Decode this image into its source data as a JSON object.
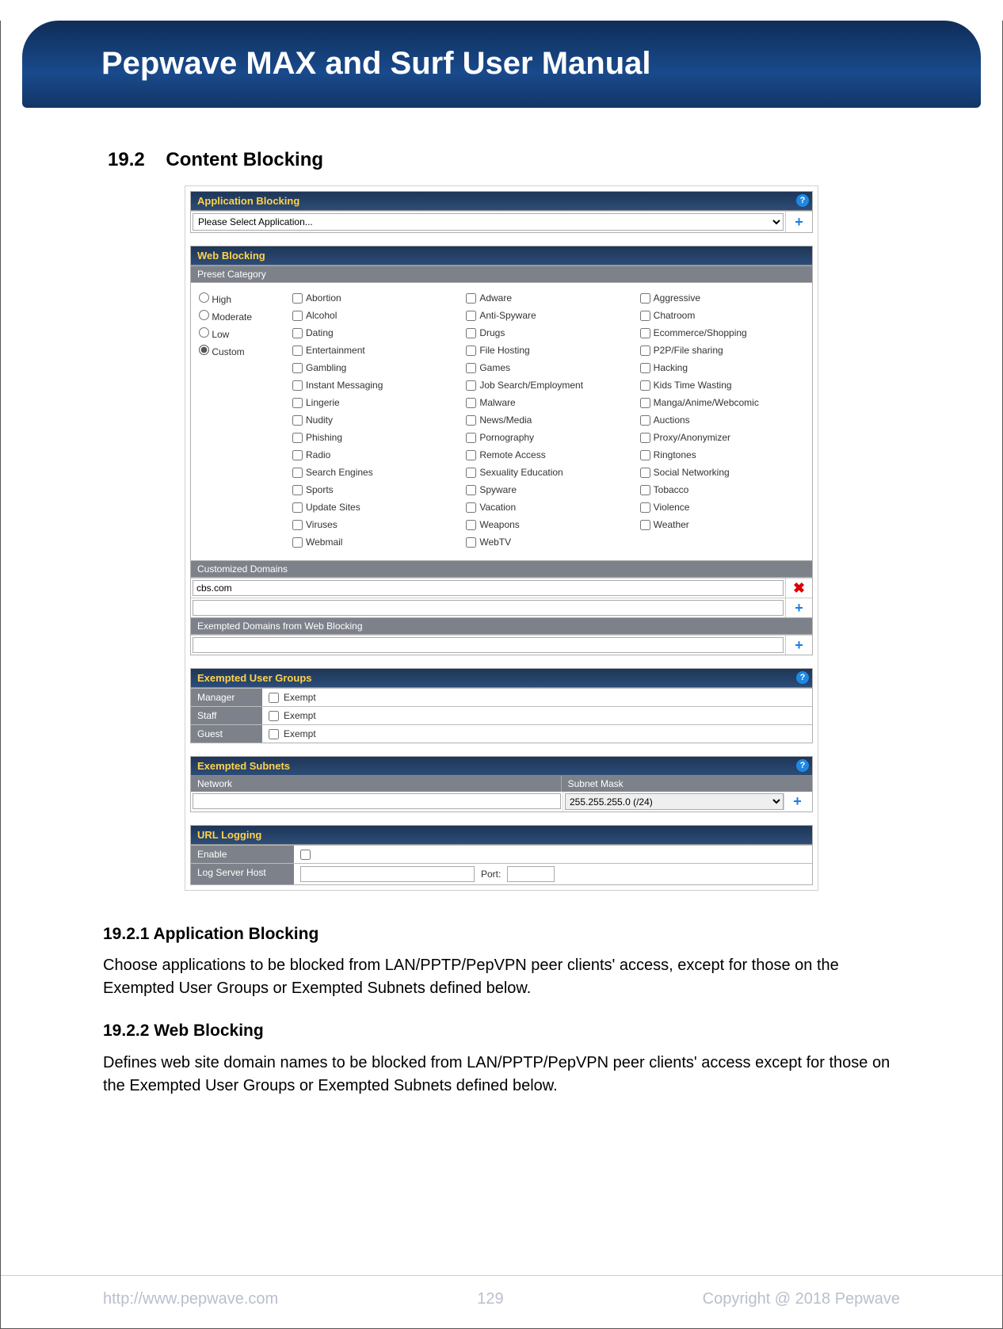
{
  "header": {
    "title": "Pepwave MAX and Surf User Manual"
  },
  "section": {
    "num": "19.2",
    "title": "Content Blocking"
  },
  "app_block": {
    "title": "Application Blocking",
    "select_placeholder": "Please Select Application..."
  },
  "web_block": {
    "title": "Web Blocking",
    "preset_label": "Preset Category",
    "presets": [
      "High",
      "Moderate",
      "Low",
      "Custom"
    ],
    "selected_preset": "Custom",
    "categories_col1": [
      "Abortion",
      "Alcohol",
      "Dating",
      "Entertainment",
      "Gambling",
      "Instant Messaging",
      "Lingerie",
      "Nudity",
      "Phishing",
      "Radio",
      "Search Engines",
      "Sports",
      "Update Sites",
      "Viruses",
      "Webmail"
    ],
    "categories_col2": [
      "Adware",
      "Anti-Spyware",
      "Drugs",
      "File Hosting",
      "Games",
      "Job Search/Employment",
      "Malware",
      "News/Media",
      "Pornography",
      "Remote Access",
      "Sexuality Education",
      "Spyware",
      "Vacation",
      "Weapons",
      "WebTV"
    ],
    "categories_col3": [
      "Aggressive",
      "Chatroom",
      "Ecommerce/Shopping",
      "P2P/File sharing",
      "Hacking",
      "Kids Time Wasting",
      "Manga/Anime/Webcomic",
      "Auctions",
      "Proxy/Anonymizer",
      "Ringtones",
      "Social Networking",
      "Tobacco",
      "Violence",
      "Weather"
    ],
    "customized_label": "Customized Domains",
    "customized_value": "cbs.com",
    "exempted_label": "Exempted Domains from Web Blocking"
  },
  "exempt_groups": {
    "title": "Exempted User Groups",
    "rows": [
      {
        "name": "Manager",
        "opt": "Exempt"
      },
      {
        "name": "Staff",
        "opt": "Exempt"
      },
      {
        "name": "Guest",
        "opt": "Exempt"
      }
    ]
  },
  "exempt_subnets": {
    "title": "Exempted Subnets",
    "col_network": "Network",
    "col_mask": "Subnet Mask",
    "mask_value": "255.255.255.0 (/24)"
  },
  "url_logging": {
    "title": "URL Logging",
    "enable_label": "Enable",
    "host_label": "Log Server Host",
    "port_label": "Port:"
  },
  "text": {
    "h1": "19.2.1 Application Blocking",
    "p1": "Choose applications to be blocked from LAN/PPTP/PepVPN peer clients' access, except for those on the Exempted User Groups or Exempted Subnets defined below.",
    "h2": "19.2.2 Web Blocking",
    "p2": "Defines web site domain names to be blocked from LAN/PPTP/PepVPN peer clients' access except for those on the Exempted User Groups or Exempted Subnets defined below."
  },
  "footer": {
    "url": "http://www.pepwave.com",
    "page": "129",
    "copyright": "Copyright @ 2018 Pepwave"
  }
}
